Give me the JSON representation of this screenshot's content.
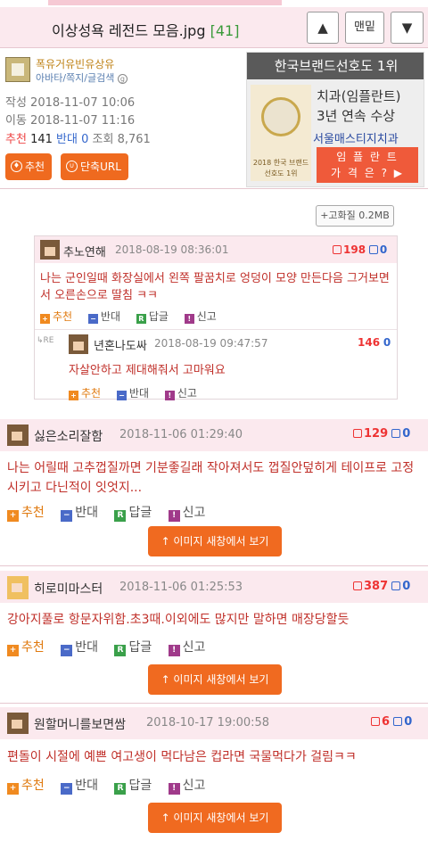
{
  "header": {
    "title": "이상성욕 레전드 모음.jpg",
    "count": "[41]",
    "btn_up": "▲",
    "btn_top": "맨밑",
    "btn_down": "▼"
  },
  "post": {
    "author": "폭유거유빈유상유",
    "user_links": "아바타/쪽지/글검색",
    "created": "작성 2018-11-07 10:06",
    "moved": "이동 2018-11-07 11:16",
    "rec_label": "추천",
    "rec_count": "141",
    "opp_label": "반대",
    "opp_count": "0",
    "views": "조회 8,761",
    "btn_recommend": "추천",
    "btn_short_url": "단축URL"
  },
  "ad": {
    "top": "한국브랜드선호도 1위",
    "line1": "치과(임플란트)",
    "line2": "3년 연속 수상",
    "line3": "서울매스티지치과",
    "cta1": "임 플 란 트",
    "cta2": "가 격 은 ? ▶",
    "logo_line1": "2018 한국 브랜드",
    "logo_line2": "선호도 1위"
  },
  "hq_button": "+고화질 0.2MB",
  "actions": {
    "rec": "추천",
    "opp": "반대",
    "reply": "답글",
    "report": "신고"
  },
  "img_button": "↑ 이미지 새창에서 보기",
  "comments": [
    {
      "nick": "추노연해",
      "time": "2018-08-19 08:36:01",
      "up": "198",
      "down": "0",
      "text": "나는 군인일때 화장실에서 왼쪽 팔꿈치로 엉덩이 모양 만든다음 그거보면서 오른손으로 딸침 ㅋㅋ",
      "reply": {
        "tag": "RE",
        "nick": "년혼나도싸",
        "time": "2018-08-19 09:47:57",
        "score": "146",
        "down": "0",
        "text": "자살안하고 제대해줘서 고마워요"
      }
    },
    {
      "nick": "싫은소리잘함",
      "time": "2018-11-06 01:29:40",
      "up": "129",
      "down": "0",
      "text": "나는 어릴때 고추껍질까면 기분좋길래 작아져서도 껍질안덮히게 테이프로 고정시키고 다닌적이 잇엇지..."
    },
    {
      "nick": "히로미마스터",
      "time": "2018-11-06 01:25:53",
      "up": "387",
      "down": "0",
      "text": "강아지풀로 항문자위함.초3때.이외에도 많지만 말하면 매장당할듯"
    },
    {
      "nick": "원할머니를보면쌈",
      "time": "2018-10-17 19:00:58",
      "up": "6",
      "down": "0",
      "text": "편돌이 시절에 예쁜 여고생이 먹다남은 컵라면 국물먹다가 걸림ㅋㅋ"
    }
  ]
}
